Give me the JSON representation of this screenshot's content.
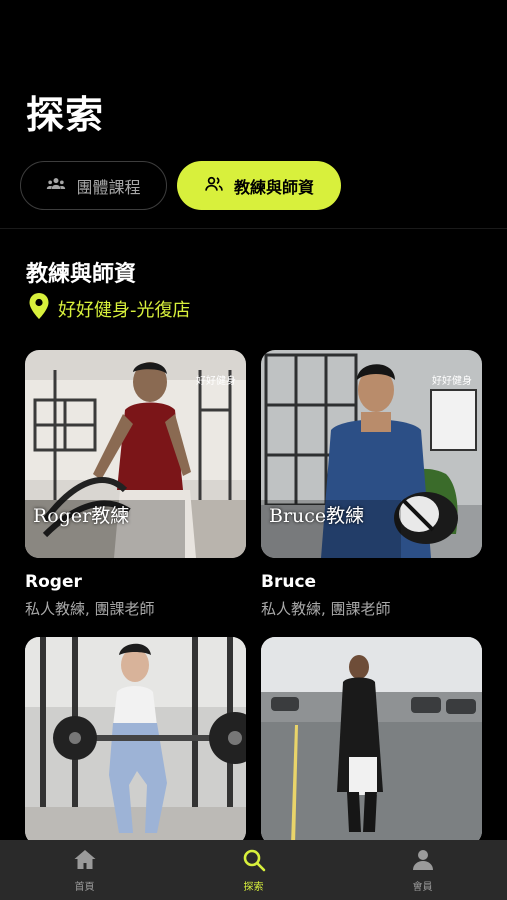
{
  "header": {
    "title": "探索"
  },
  "tabs": [
    {
      "label": "團體課程",
      "icon": "group-icon",
      "active": false
    },
    {
      "label": "教練與師資",
      "icon": "users-icon",
      "active": true
    }
  ],
  "section": {
    "title": "教練與師資",
    "location": "好好健身-光復店"
  },
  "coaches": [
    {
      "name": "Roger",
      "role": "私人教練, 團課老師",
      "overlay": "Roger教練"
    },
    {
      "name": "Bruce",
      "role": "私人教練, 團課老師",
      "overlay": "Bruce教練"
    },
    {
      "name": "",
      "role": "",
      "overlay": ""
    },
    {
      "name": "",
      "role": "",
      "overlay": ""
    }
  ],
  "brand_mark": "好好健身",
  "bottom_nav": [
    {
      "label": "首頁",
      "icon": "home-icon",
      "active": false
    },
    {
      "label": "探索",
      "icon": "search-icon",
      "active": true
    },
    {
      "label": "會員",
      "icon": "user-icon",
      "active": false
    }
  ],
  "colors": {
    "accent": "#d8f03c",
    "background": "#000000",
    "nav_bg": "#2a2a2a"
  }
}
